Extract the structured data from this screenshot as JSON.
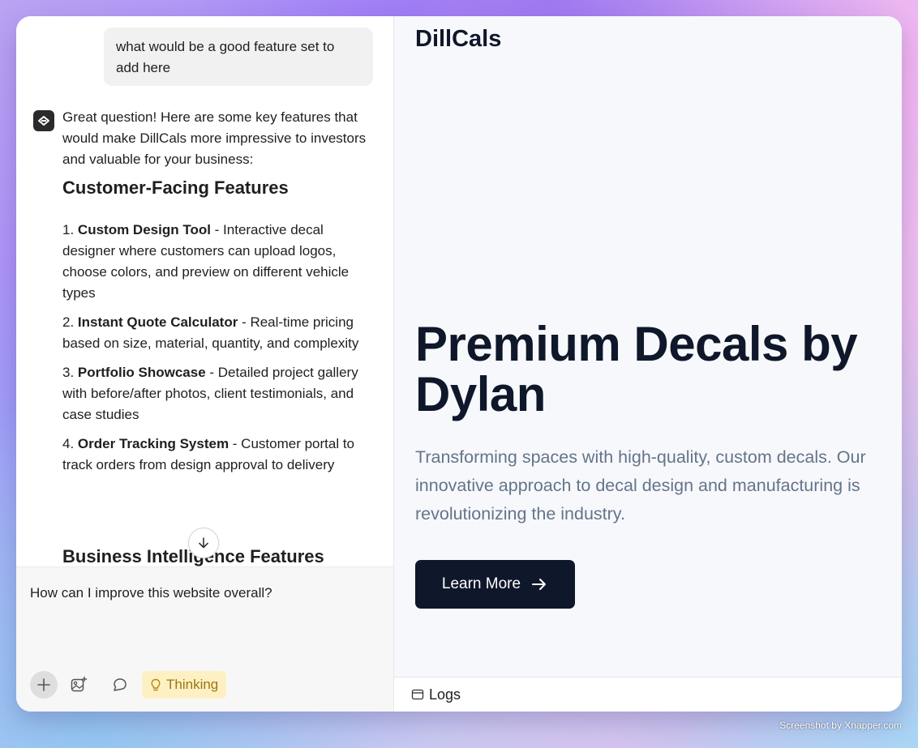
{
  "chat": {
    "user_message": "what would be a good feature set to add here",
    "assistant": {
      "intro": "Great question! Here are some key features that would make DillCals more impressive to investors and valuable for your business:",
      "section1_heading": "Customer-Facing Features",
      "items": [
        {
          "num": "1.",
          "title": "Custom Design Tool",
          "desc": " - Interactive decal designer where customers can upload logos, choose colors, and preview on different vehicle types"
        },
        {
          "num": "2.",
          "title": "Instant Quote Calculator",
          "desc": " - Real-time pricing based on size, material, quantity, and complexity"
        },
        {
          "num": "3.",
          "title": "Portfolio Showcase",
          "desc": " - Detailed project gallery with before/after photos, client testimonials, and case studies"
        },
        {
          "num": "4.",
          "title": "Order Tracking System",
          "desc": " - Customer portal to track orders from design approval to delivery"
        }
      ],
      "section2_heading": "Business Intelligence Features"
    },
    "composer": {
      "input_value": "How can I improve this website overall?",
      "thinking_label": "Thinking"
    }
  },
  "preview": {
    "brand": "DillCals",
    "hero_title": "Premium Decals by Dylan",
    "hero_subtitle": "Transforming spaces with high-quality, custom decals. Our innovative approach to decal design and manufacturing is revolutionizing the industry.",
    "cta_label": "Learn More",
    "logs_label": "Logs"
  },
  "watermark": "Screenshot by Xnapper.com",
  "colors": {
    "brand_dark": "#0f172a",
    "subtitle": "#64748b",
    "thinking_bg": "#fdf1c4",
    "thinking_text": "#a07410"
  }
}
